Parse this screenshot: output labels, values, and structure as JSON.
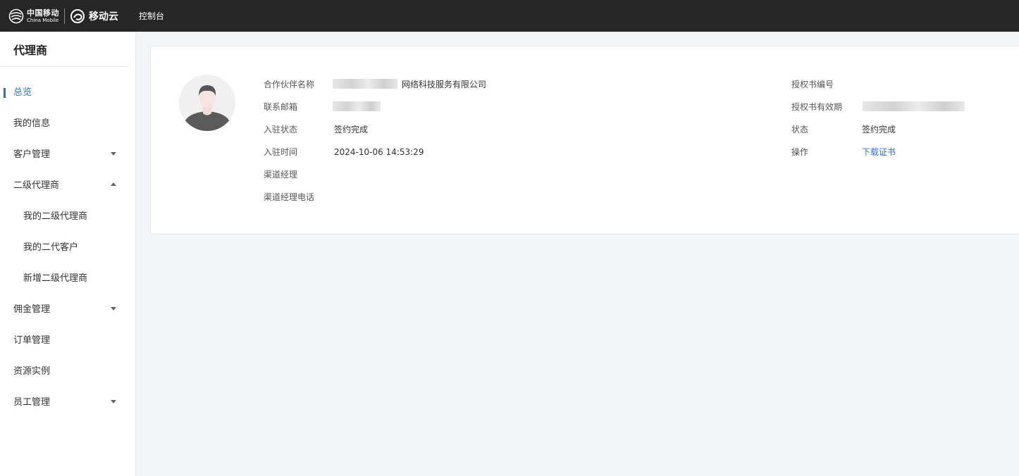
{
  "brand": {
    "cm_cn": "中国移动",
    "cm_en": "China Mobile",
    "cloud": "移动云"
  },
  "topnav": {
    "console": "控制台"
  },
  "sidebar": {
    "title": "代理商",
    "items": [
      {
        "label": "总览",
        "active": true
      },
      {
        "label": "我的信息"
      },
      {
        "label": "客户管理",
        "caret": "down"
      },
      {
        "label": "二级代理商",
        "caret": "up"
      },
      {
        "label": "我的二级代理商",
        "sub": true
      },
      {
        "label": "我的二代客户",
        "sub": true
      },
      {
        "label": "新增二级代理商",
        "sub": true
      },
      {
        "label": "佣金管理",
        "caret": "down"
      },
      {
        "label": "订单管理"
      },
      {
        "label": "资源实例"
      },
      {
        "label": "员工管理",
        "caret": "down"
      }
    ]
  },
  "info": {
    "partner_name_label": "合作伙伴名称",
    "partner_name_suffix": "网络科技服务有限公司",
    "email_label": "联系邮箱",
    "entry_status_label": "入驻状态",
    "entry_status_value": "签约完成",
    "entry_time_label": "入驻时间",
    "entry_time_value": "2024-10-06 14:53:29",
    "channel_manager_label": "渠道经理",
    "channel_phone_label": "渠道经理电话",
    "auth_no_label": "授权书编号",
    "auth_valid_label": "授权书有效期",
    "status_label": "状态",
    "status_value": "签约完成",
    "action_label": "操作",
    "action_link": "下载证书"
  },
  "colors": {
    "topbar": "#262626",
    "accent": "#2d6fd6",
    "background": "#f3f6f9"
  }
}
